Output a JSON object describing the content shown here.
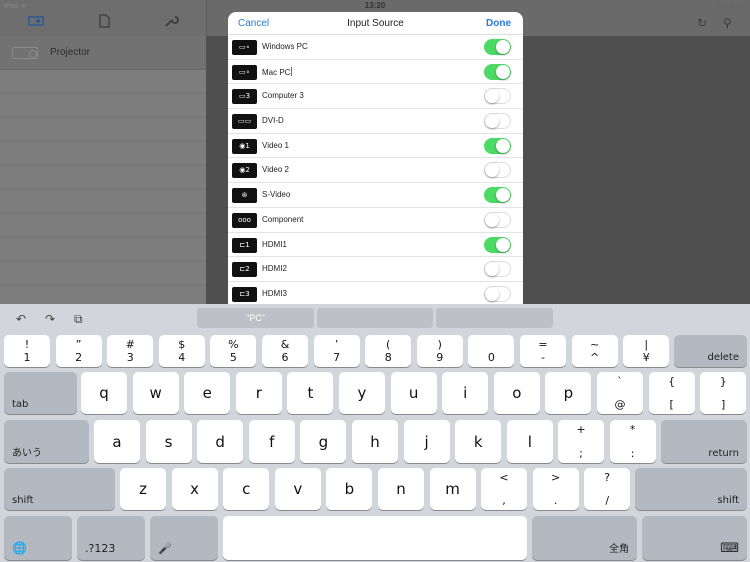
{
  "status": {
    "left": "iPad ᯤ",
    "time": "13:20",
    "right": "✱ 5% ▭"
  },
  "left_panel": {
    "projector_label": "Projector"
  },
  "right_toolbar": {
    "refresh": "↻",
    "search": "⚲"
  },
  "modal": {
    "cancel": "Cancel",
    "title": "Input Source",
    "done": "Done",
    "rows": [
      {
        "label": "Windows PC",
        "icon": "▭∘",
        "on": true
      },
      {
        "label": "Mac PC",
        "icon": "▭∘",
        "on": true
      },
      {
        "label": "Computer 3",
        "icon": "▭3",
        "on": false
      },
      {
        "label": "DVI-D",
        "icon": "▭▭",
        "on": false
      },
      {
        "label": "Video 1",
        "icon": "◉1",
        "on": true
      },
      {
        "label": "Video 2",
        "icon": "◉2",
        "on": false
      },
      {
        "label": "S-Video",
        "icon": "⊛",
        "on": true
      },
      {
        "label": "Component",
        "icon": "ooo",
        "on": false
      },
      {
        "label": "HDMI1",
        "icon": "⊏1",
        "on": true
      },
      {
        "label": "HDMI2",
        "icon": "⊏2",
        "on": false
      },
      {
        "label": "HDMI3",
        "icon": "⊏3",
        "on": false
      }
    ]
  },
  "keyboard": {
    "suggestion": "“PC”",
    "undo": "↶",
    "redo": "↷",
    "paste": "⧉",
    "row1": [
      {
        "t": "!",
        "b": "1"
      },
      {
        "t": "”",
        "b": "2"
      },
      {
        "t": "#",
        "b": "3"
      },
      {
        "t": "$",
        "b": "4"
      },
      {
        "t": "%",
        "b": "5"
      },
      {
        "t": "&",
        "b": "6"
      },
      {
        "t": "’",
        "b": "7"
      },
      {
        "t": "(",
        "b": "8"
      },
      {
        "t": ")",
        "b": "9"
      },
      {
        "t": "",
        "b": "0"
      },
      {
        "t": "=",
        "b": "-"
      },
      {
        "t": "~",
        "b": "^"
      },
      {
        "t": "|",
        "b": "¥"
      }
    ],
    "delete": "delete",
    "tab": "tab",
    "row2": [
      "q",
      "w",
      "e",
      "r",
      "t",
      "y",
      "u",
      "i",
      "o",
      "p"
    ],
    "row2_sym": [
      {
        "t": "`",
        "b": "@"
      },
      {
        "t": "{",
        "b": "["
      },
      {
        "t": "}",
        "b": "]"
      }
    ],
    "kana": "あいう",
    "row3": [
      "a",
      "s",
      "d",
      "f",
      "g",
      "h",
      "j",
      "k",
      "l"
    ],
    "row3_sym": [
      {
        "t": "+",
        "b": ";"
      },
      {
        "t": "*",
        "b": ":"
      }
    ],
    "return": "return",
    "shift": "shift",
    "row4": [
      "z",
      "x",
      "c",
      "v",
      "b",
      "n",
      "m"
    ],
    "row4_sym": [
      {
        "t": "<",
        "b": ","
      },
      {
        "t": ">",
        "b": "."
      },
      {
        "t": "?",
        "b": "/"
      }
    ],
    "globe": "🌐",
    "numbers": ".?123",
    "mic": "🎤",
    "zenkaku": "全角",
    "hide": "⌨"
  }
}
